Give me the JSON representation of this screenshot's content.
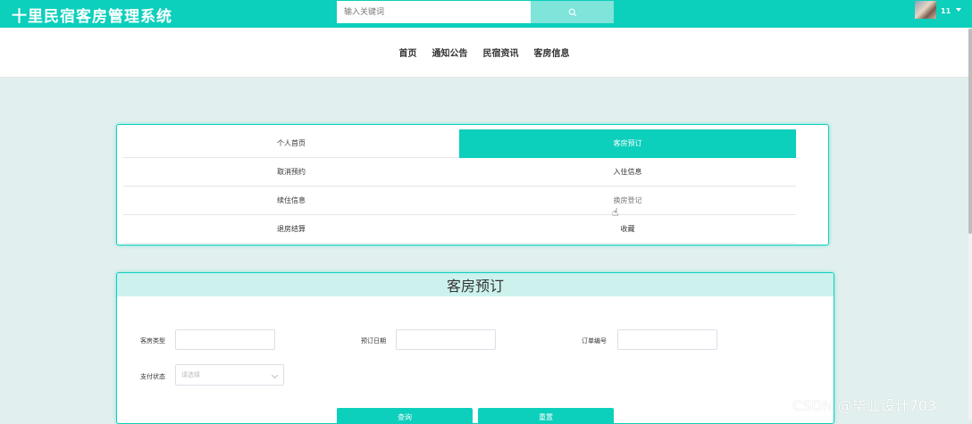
{
  "header": {
    "site_title": "十里民宿客房管理系统",
    "search_placeholder": "输入关键词",
    "search_icon": "search-icon",
    "username": "11"
  },
  "nav": {
    "items": [
      "首页",
      "通知公告",
      "民宿资讯",
      "客房信息"
    ]
  },
  "menu": {
    "items": [
      {
        "label": "个人首页",
        "active": false
      },
      {
        "label": "客房预订",
        "active": true
      },
      {
        "label": "取消预约",
        "active": false
      },
      {
        "label": "入住信息",
        "active": false
      },
      {
        "label": "续住信息",
        "active": false
      },
      {
        "label": "换房登记",
        "active": false
      },
      {
        "label": "退房结算",
        "active": false
      },
      {
        "label": "收藏",
        "active": false
      }
    ]
  },
  "form": {
    "title": "客房预订",
    "room_type_label": "客房类型",
    "room_type_value": "",
    "booking_date_label": "预订日期",
    "booking_date_value": "",
    "order_no_label": "订单编号",
    "order_no_value": "",
    "pay_status_label": "支付状态",
    "pay_status_placeholder": "请选择",
    "query_button": "查询",
    "reset_button": "重置"
  },
  "watermark": "CSDN @毕业设计703",
  "colors": {
    "accent": "#0ccfbc",
    "accent_light": "#7fe4da",
    "header_bg": "#cdf2ee",
    "page_bg": "#e1f0ee"
  }
}
